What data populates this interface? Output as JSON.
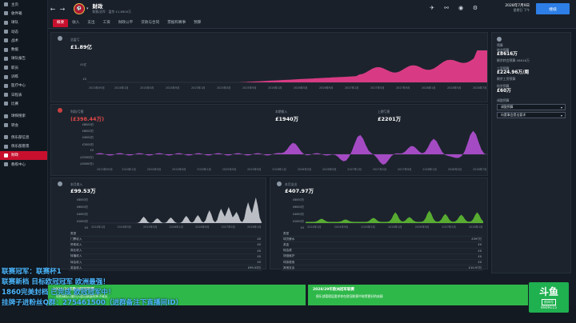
{
  "sidebar": {
    "items": [
      {
        "label": "主页",
        "icon": "home-icon"
      },
      {
        "label": "收件箱",
        "icon": "inbox-icon"
      },
      {
        "label": "球队",
        "icon": "squad-icon"
      },
      {
        "label": "动态",
        "icon": "dynamics-icon"
      },
      {
        "label": "战术",
        "icon": "tactics-icon"
      },
      {
        "label": "数据",
        "icon": "data-icon"
      },
      {
        "label": "球队报告",
        "icon": "report-icon"
      },
      {
        "label": "职员",
        "icon": "staff-icon"
      },
      {
        "label": "训练",
        "icon": "training-icon"
      },
      {
        "label": "医疗中心",
        "icon": "medical-icon"
      },
      {
        "label": "日程表",
        "icon": "calendar-icon"
      },
      {
        "label": "比赛",
        "icon": "match-icon"
      },
      {
        "label": "球探搜索",
        "icon": "scouting-icon"
      },
      {
        "label": "转会",
        "icon": "transfer-icon"
      },
      {
        "label": "俱乐部信息",
        "icon": "club-info-icon"
      },
      {
        "label": "俱乐部愿景",
        "icon": "vision-icon"
      },
      {
        "label": "财政",
        "icon": "finance-icon"
      },
      {
        "label": "教练中心",
        "icon": "coach-icon"
      }
    ]
  },
  "topbar": {
    "title": "财政",
    "club_sub": "联赛/冠军 · 盈余 £1.8900万",
    "date": "2028年7月9日",
    "date_sub": "星期日 下午",
    "continue": "继续"
  },
  "tabs": [
    "概要",
    "收入",
    "支出",
    "工资",
    "财政公平",
    "贷款与合同",
    "票据和赛事",
    "预算"
  ],
  "balance": {
    "label": "总盈亏",
    "value": "£1.89亿",
    "y_ticks": [
      "£1亿",
      "£0"
    ],
    "x_ticks": [
      "2023年09月",
      "2024年1月",
      "2024年5月",
      "2024年9月",
      "2025年1月",
      "2025年5月",
      "2025年9月",
      "2026年1月",
      "2026年5月",
      "2026年9月",
      "2027年1月",
      "2027年5月",
      "2027年9月",
      "2028年1月",
      "2028年5月",
      "2028年7月"
    ]
  },
  "profit": {
    "label": "利润/亏损",
    "value": "(£398.44万)",
    "icon": "down-arrow-icon",
    "mid_label": "本期收入",
    "mid_value": "£1940万",
    "right_label": "上期亏损",
    "right_value": "£2201万",
    "y_ticks": [
      "£8000万",
      "£6000万",
      "£4000万",
      "£2000万",
      "£0",
      "(£2000万)",
      "(£4000万)"
    ],
    "x_ticks": [
      "2023年09月",
      "2024年1月",
      "2024年5月",
      "2024年9月",
      "2025年1月",
      "2025年5月",
      "2025年9月",
      "2026年1月",
      "2026年5月",
      "2026年9月",
      "2027年1月",
      "2027年5月",
      "2027年9月",
      "2028年1月",
      "2028年5月",
      "2028年7月"
    ]
  },
  "income": {
    "label": "本月收入",
    "value": "£99.53万",
    "y_ticks": [
      "£8000万",
      "£6000万",
      "£4000万",
      "£2000万",
      "£0"
    ],
    "x_ticks": [
      "2024年1月",
      "2024年9月",
      "2025年5月",
      "2026年1月",
      "2026年9月",
      "2027年5月",
      "2028年1月"
    ],
    "rows": [
      {
        "k": "门票收入",
        "v": "£0"
      },
      {
        "k": "赞助收入",
        "v": "£0"
      },
      {
        "k": "商业收入",
        "v": "£0"
      },
      {
        "k": "转播收入",
        "v": "£0"
      },
      {
        "k": "转会收入",
        "v": "£0"
      },
      {
        "k": "奖金收入",
        "v": "£99.53万"
      }
    ],
    "header": "类型"
  },
  "expense": {
    "label": "本月支出",
    "value": "£407.97万",
    "y_ticks": [
      "£8000万",
      "£6000万",
      "£4000万",
      "£2000万",
      "£0"
    ],
    "x_ticks": [
      "2024年1月",
      "2024年9月",
      "2025年5月",
      "2026年1月",
      "2026年9月",
      "2027年5月",
      "2028年1月"
    ],
    "rows": [
      {
        "k": "球员薪水",
        "v": "£397万"
      },
      {
        "k": "奖金",
        "v": "£0"
      },
      {
        "k": "转会费",
        "v": "£0"
      },
      {
        "k": "场馆维护",
        "v": "£0"
      },
      {
        "k": "球探费用",
        "v": "£0"
      },
      {
        "k": "其他支出",
        "v": "£10.97万"
      }
    ],
    "header": "类型"
  },
  "right_panel": {
    "title": "预算",
    "rows": [
      {
        "k": "转会预算",
        "v": "£8616万"
      },
      {
        "k": "剩余转会预算 £8616万",
        "v": ""
      },
      {
        "k": "工资预算",
        "v": "£224.96万/周"
      },
      {
        "k": "剩余工资预算",
        "v": ""
      },
      {
        "k": "结余预算",
        "v": "£60万"
      }
    ],
    "drop_label": "调整预算",
    "drop1": "调整预算",
    "drop2": "向董事会提出要求"
  },
  "overlay": [
    "联赛冠军：联赛杯1",
    "联赛新档 目标欧冠冠军 欧洲最强！",
    "1860完美封档 已完成 欧冠冠军中！",
    "挂牌子进粉丝Q群：275461500（进群备注下直播间ID）"
  ],
  "news": [
    {
      "title": "2028/29年欧洲冠军联赛",
      "text": "你的球队已被列入欧冠联赛的种子球队"
    },
    {
      "title": "2028/29年欧洲冠军联赛",
      "text": "俱乐部管理层要求你在欧冠联赛中取得更好的成绩"
    }
  ],
  "streamer": {
    "logo": "斗鱼",
    "sub": "房间号",
    "room": "8909115"
  },
  "colors": {
    "accent": "#c8102e",
    "pink": "#e83e8c",
    "purple": "#b04fd0",
    "green": "#5cb832",
    "overlay_text": "#4db8ff",
    "news_green": "#2fb84a"
  }
}
